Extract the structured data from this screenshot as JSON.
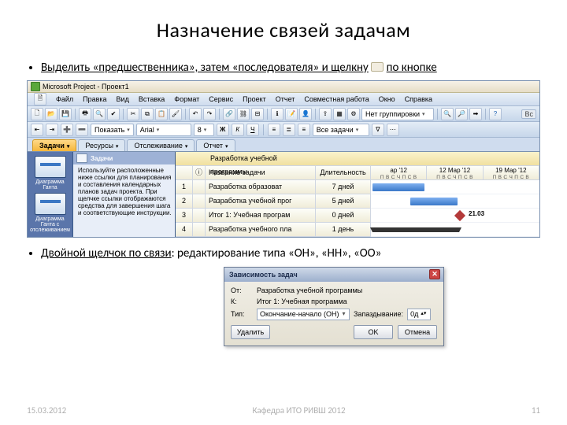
{
  "slide": {
    "title": "Назначение связей задачам",
    "bullet1_a": "Выделить «предшественника», затем «последователя» и щелкну",
    "bullet1_b": "по кнопке",
    "bullet2_a": "Двойной щелчок по связи",
    "bullet2_b": ": редактирование типа «ОН», «НН», «ОО»"
  },
  "footer": {
    "date": "15.03.2012",
    "org": "Кафедра ИТО РИВШ 2012",
    "page": "11"
  },
  "mp": {
    "title": "Microsoft Project - Проект1",
    "menu": [
      "Файл",
      "Правка",
      "Вид",
      "Вставка",
      "Формат",
      "Сервис",
      "Проект",
      "Отчет",
      "Совместная работа",
      "Окно",
      "Справка"
    ],
    "group_label": "Нет группировки",
    "right_btn": "Вс",
    "font_name": "Arial",
    "font_size": "8",
    "show_label": "Показать",
    "alltasks_label": "Все задачи",
    "tabs": [
      "Задачи",
      "Ресурсы",
      "Отслеживание",
      "Отчет"
    ],
    "yellow_caption": "Разработка учебной программы",
    "guide": {
      "header": "Задачи",
      "icon1": "Диаграмма Ганта",
      "icon2": "Диаграмма Ганта с отслеживанием",
      "text": "Используйте расположенные ниже ссылки для планирования и составления календарных планов задач проекта. При щелчке ссылки отображаются средства для завершения шага и соответствующие инструкции."
    },
    "columns": {
      "num": "",
      "i": "",
      "name": "Название задачи",
      "dur": "Длительность"
    },
    "rows": [
      {
        "n": "1",
        "name": "Разработка образоват",
        "dur": "7 дней"
      },
      {
        "n": "2",
        "name": "Разработка учебной прог",
        "dur": "5 дней"
      },
      {
        "n": "3",
        "name": "Итог 1: Учебная програм",
        "dur": "0 дней"
      },
      {
        "n": "4",
        "name": "Разработка учебного пла",
        "dur": "1 день"
      }
    ],
    "timeline": [
      "ар '12",
      "12 Мар '12",
      "19 Мар '12"
    ],
    "timeline_days": "П В С Ч П С В",
    "diamond_label": "21.03"
  },
  "dialog": {
    "title": "Зависимость задач",
    "from_label": "От:",
    "from_value": "Разработка учебной программы",
    "to_label": "К:",
    "to_value": "Итог 1: Учебная программа",
    "type_label": "Тип:",
    "type_value": "Окончание-начало (ОН)",
    "lag_label": "Запаздывание:",
    "lag_value": "0д",
    "btn_delete": "Удалить",
    "btn_ok": "OK",
    "btn_cancel": "Отмена"
  }
}
